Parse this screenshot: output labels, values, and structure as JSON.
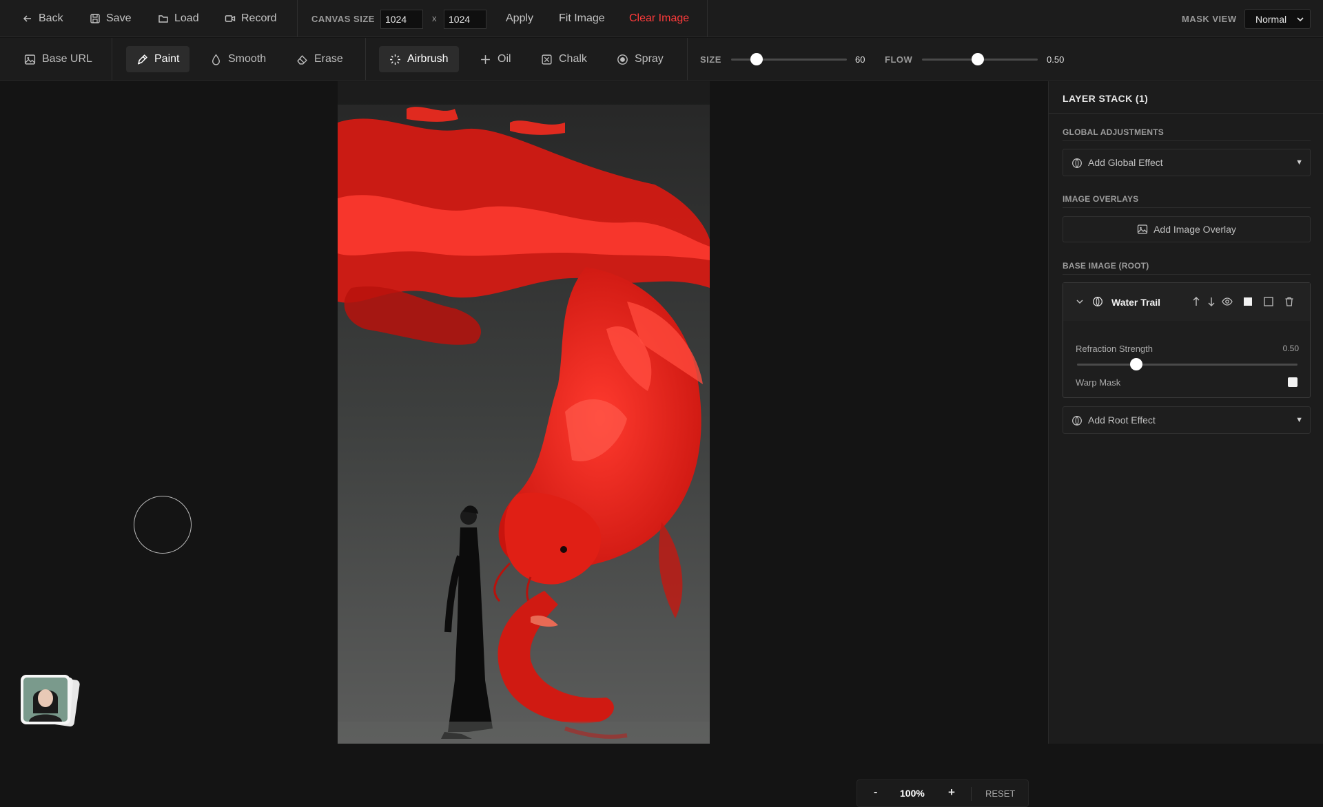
{
  "topbar": {
    "back": "Back",
    "save": "Save",
    "load": "Load",
    "record": "Record",
    "canvas_size_label": "CANVAS SIZE",
    "width": "1024",
    "times": "x",
    "height": "1024",
    "apply": "Apply",
    "fit_image": "Fit Image",
    "clear_image": "Clear Image",
    "mask_view_label": "MASK VIEW",
    "mask_view_value": "Normal"
  },
  "toolbar": {
    "base_url": "Base URL",
    "paint": "Paint",
    "smooth": "Smooth",
    "erase": "Erase",
    "airbrush": "Airbrush",
    "oil": "Oil",
    "chalk": "Chalk",
    "spray": "Spray",
    "size_label": "SIZE",
    "size_value": "60",
    "size_fraction": 0.22,
    "flow_label": "FLOW",
    "flow_value": "0.50",
    "flow_fraction": 0.48
  },
  "zoom": {
    "minus": "-",
    "level": "100%",
    "plus": "+",
    "reset": "RESET"
  },
  "panel": {
    "title": "LAYER STACK (1)",
    "global_section": "GLOBAL ADJUSTMENTS",
    "add_global": "Add Global Effect",
    "overlays_section": "IMAGE OVERLAYS",
    "add_overlay": "Add Image Overlay",
    "base_section": "BASE IMAGE (ROOT)",
    "layer": {
      "name": "Water Trail",
      "refraction_label": "Refraction Strength",
      "refraction_value": "0.50",
      "refraction_fraction": 0.27,
      "warp_mask_label": "Warp Mask"
    },
    "add_root": "Add Root Effect"
  },
  "colors": {
    "accent_red": "#ff3b3b",
    "panel_bg": "#1c1c1c",
    "canvas_bg": "#141414"
  }
}
